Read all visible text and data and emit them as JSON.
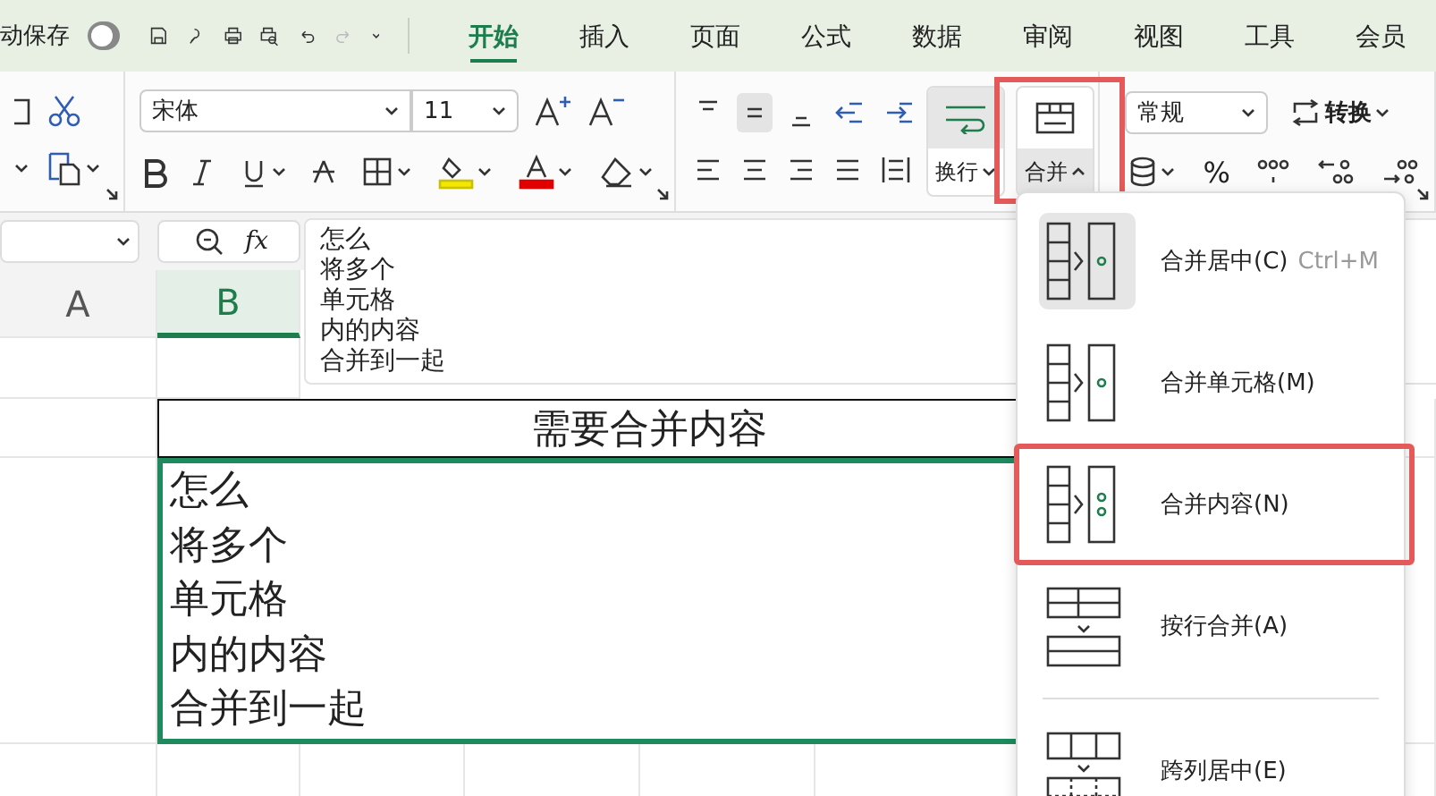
{
  "quick_access": {
    "autosave_label": "动保存",
    "autosave_on": false,
    "redo_disabled": true
  },
  "tabs": [
    {
      "label": "开始",
      "selected": true
    },
    {
      "label": "插入",
      "selected": false
    },
    {
      "label": "页面",
      "selected": false
    },
    {
      "label": "公式",
      "selected": false
    },
    {
      "label": "数据",
      "selected": false
    },
    {
      "label": "审阅",
      "selected": false
    },
    {
      "label": "视图",
      "selected": false
    },
    {
      "label": "工具",
      "selected": false
    },
    {
      "label": "会员",
      "selected": false
    }
  ],
  "ribbon": {
    "font_name": "宋体",
    "font_size": "11",
    "middle_align_on": true,
    "wrap_on": true,
    "wrap_label": "换行",
    "merge_label": "合并",
    "merge_highlighted": true,
    "number_format": "常规",
    "convert_label": "转换",
    "percent": "%"
  },
  "formula_bar": {
    "fx": "fx",
    "content_lines": [
      "怎么",
      "将多个",
      "单元格",
      "内的内容",
      "合并到一起"
    ]
  },
  "columns": [
    {
      "label": "A",
      "selected": false
    },
    {
      "label": "B",
      "selected": true
    }
  ],
  "sheet": {
    "title_cell": "需要合并内容",
    "merged_cell_lines": [
      "怎么",
      "将多个",
      "单元格",
      "内的内容",
      "合并到一起"
    ]
  },
  "merge_menu": [
    {
      "kind": "center",
      "label": "合并居中(C)",
      "shortcut": "Ctrl+M",
      "hovered": true,
      "highlighted": false
    },
    {
      "kind": "cells",
      "label": "合并单元格(M)",
      "hovered": false,
      "highlighted": false
    },
    {
      "kind": "content",
      "label": "合并内容(N)",
      "hovered": false,
      "highlighted": true
    },
    {
      "kind": "rows",
      "label": "按行合并(A)",
      "hovered": false,
      "highlighted": false
    },
    {
      "kind": "across",
      "label": "跨列居中(E)",
      "hovered": false,
      "highlighted": false
    }
  ]
}
